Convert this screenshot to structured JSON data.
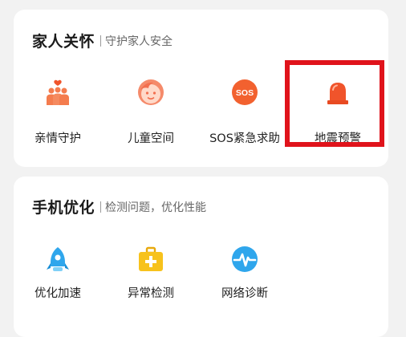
{
  "family_card": {
    "title": "家人关怀",
    "subtitle": "守护家人安全",
    "items": [
      {
        "label": "亲情守护",
        "icon": "family-icon"
      },
      {
        "label": "儿童空间",
        "icon": "child-face-icon"
      },
      {
        "label": "SOS紧急求助",
        "icon": "sos-icon",
        "icon_text": "SOS"
      },
      {
        "label": "地震预警",
        "icon": "earthquake-alarm-icon"
      }
    ]
  },
  "phone_card": {
    "title": "手机优化",
    "subtitle": "检测问题，优化性能",
    "items": [
      {
        "label": "优化加速",
        "icon": "rocket-icon"
      },
      {
        "label": "异常检测",
        "icon": "first-aid-kit-icon"
      },
      {
        "label": "网络诊断",
        "icon": "network-pulse-icon"
      }
    ]
  },
  "colors": {
    "orange": "#f47c4e",
    "sos_orange": "#f2612f",
    "alarm_red": "#f0542b",
    "blue": "#2fa6ec",
    "yellow": "#f7c21c",
    "highlight": "#e0131b"
  }
}
